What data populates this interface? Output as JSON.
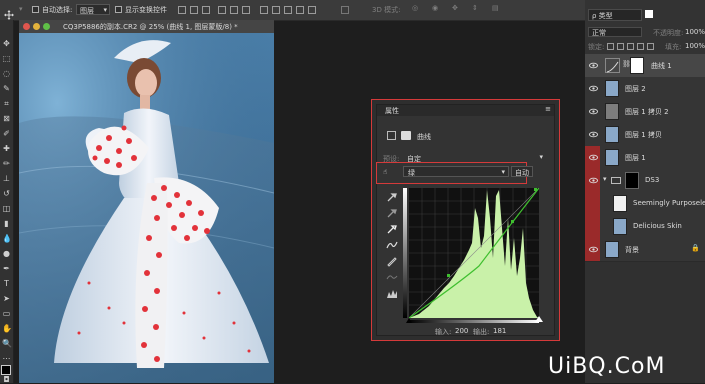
{
  "options_bar": {
    "auto_select_label": "自动选择:",
    "auto_select_value": "图层",
    "show_transform_label": "显示变换控件",
    "mode_3d_label": "3D 模式:"
  },
  "document": {
    "tab_title": "CQ3P5886的副本.CR2 @ 25% (曲线 1, 图层蒙版/8) *"
  },
  "right_panel": {
    "search_placeholder": "ρ 类型",
    "blend_mode": "正常",
    "opacity_label": "不透明度:",
    "opacity_value": "100%",
    "lock_label": "锁定:",
    "fill_label": "填充:",
    "fill_value": "100%",
    "layers": [
      {
        "name": "曲线 1",
        "kind": "adjustment",
        "selected": true
      },
      {
        "name": "图层 2",
        "kind": "photo"
      },
      {
        "name": "图层 1 拷贝 2",
        "kind": "gray"
      },
      {
        "name": "图层 1 拷贝",
        "kind": "photo"
      },
      {
        "name": "图层 1",
        "kind": "photo"
      },
      {
        "name": "DS3",
        "kind": "group"
      },
      {
        "name": "Seemingly Purposele...",
        "kind": "white"
      },
      {
        "name": "Delicious Skin",
        "kind": "photo"
      },
      {
        "name": "背景",
        "kind": "photo",
        "locked": true
      }
    ]
  },
  "curves_panel": {
    "tab_label": "属性",
    "title": "曲线",
    "preset_label": "预设:",
    "preset_value": "自定",
    "channel_value": "绿",
    "auto_button": "自动",
    "input_label": "输入:",
    "input_value": "200",
    "output_label": "输出:",
    "output_value": "181"
  },
  "colors": {
    "highlight_border": "#d53a3a",
    "histogram_fill": "#c9f1a9",
    "curve_line": "#3fbf2f"
  },
  "watermark": "UiBQ.CoM"
}
